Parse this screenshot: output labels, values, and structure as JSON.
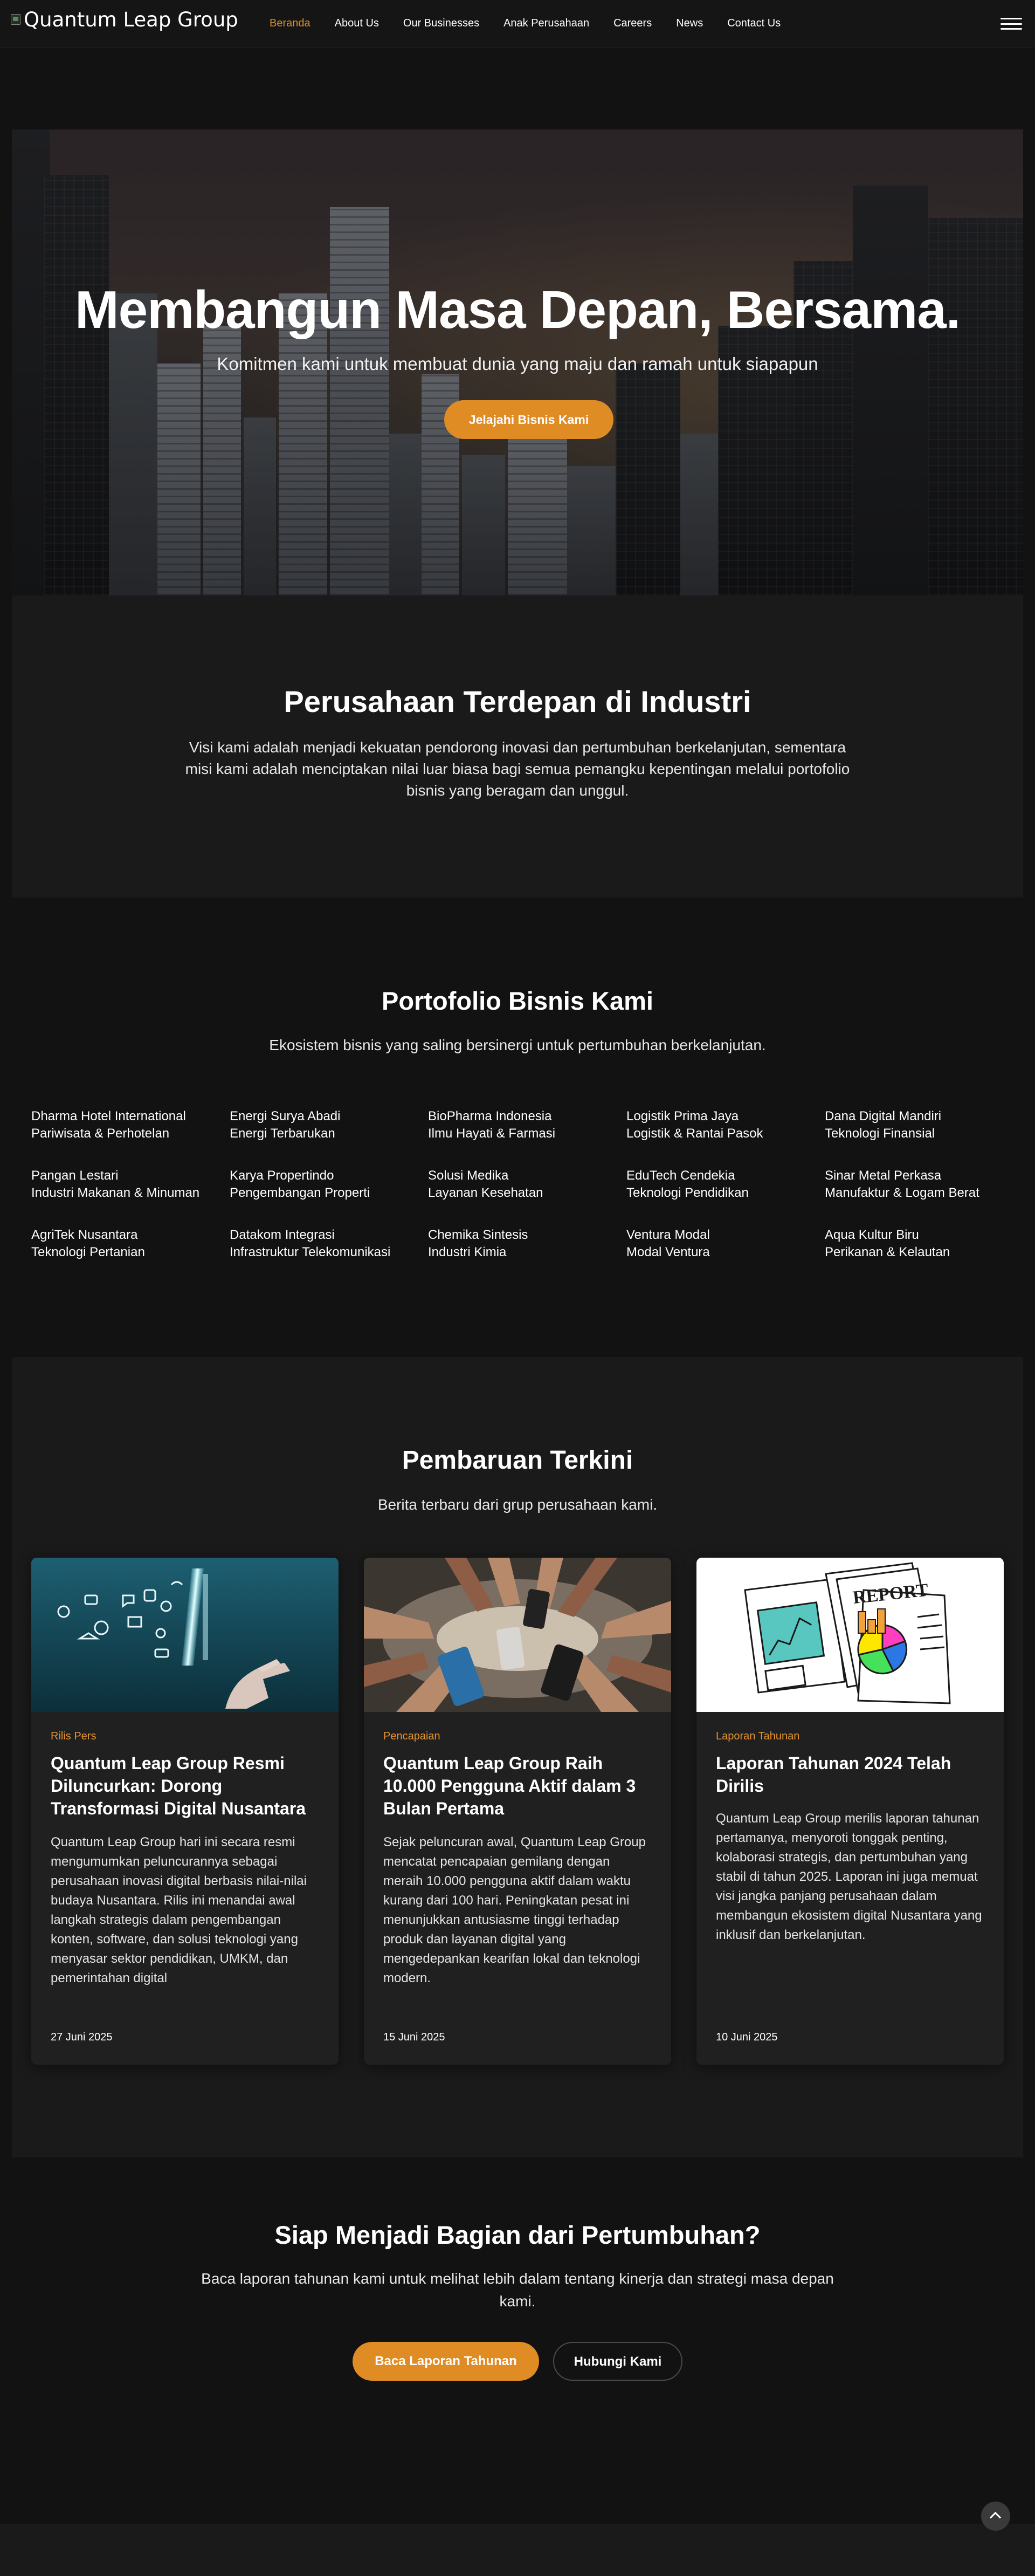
{
  "nav": {
    "logo_text": "Quantum Leap Group",
    "items": [
      {
        "label": "Beranda",
        "active": true
      },
      {
        "label": "About Us"
      },
      {
        "label": "Our Businesses"
      },
      {
        "label": "Anak Perusahaan"
      },
      {
        "label": "Careers"
      },
      {
        "label": "News"
      },
      {
        "label": "Contact Us"
      }
    ]
  },
  "hero": {
    "title": "Membangun Masa Depan, Bersama.",
    "subtitle": "Komitmen kami untuk membuat dunia yang maju dan ramah untuk siapapun",
    "button": "Jelajahi Bisnis Kami"
  },
  "about": {
    "title": "Perusahaan Terdepan di Industri",
    "text": "Visi kami adalah menjadi kekuatan pendorong inovasi dan pertumbuhan berkelanjutan, sementara misi kami adalah menciptakan nilai luar biasa bagi semua pemangku kepentingan melalui portofolio bisnis yang beragam dan unggul."
  },
  "portfolio": {
    "title": "Portofolio Bisnis Kami",
    "subtitle": "Ekosistem bisnis yang saling bersinergi untuk pertumbuhan berkelanjutan.",
    "items": [
      {
        "name": "Dharma Hotel International",
        "category": "Pariwisata & Perhotelan"
      },
      {
        "name": "Energi Surya Abadi",
        "category": "Energi Terbarukan"
      },
      {
        "name": "BioPharma Indonesia",
        "category": "Ilmu Hayati & Farmasi"
      },
      {
        "name": "Logistik Prima Jaya",
        "category": "Logistik & Rantai Pasok"
      },
      {
        "name": "Dana Digital Mandiri",
        "category": "Teknologi Finansial"
      },
      {
        "name": "Pangan Lestari",
        "category": "Industri Makanan & Minuman"
      },
      {
        "name": "Karya Propertindo",
        "category": "Pengembangan Properti"
      },
      {
        "name": "Solusi Medika",
        "category": "Layanan Kesehatan"
      },
      {
        "name": "EduTech Cendekia",
        "category": "Teknologi Pendidikan"
      },
      {
        "name": "Sinar Metal Perkasa",
        "category": "Manufaktur & Logam Berat"
      },
      {
        "name": "AgriTek Nusantara",
        "category": "Teknologi Pertanian"
      },
      {
        "name": "Datakom Integrasi",
        "category": "Infrastruktur Telekomunikasi"
      },
      {
        "name": "Chemika Sintesis",
        "category": "Industri Kimia"
      },
      {
        "name": "Ventura Modal",
        "category": "Modal Ventura"
      },
      {
        "name": "Aqua Kultur Biru",
        "category": "Perikanan & Kelautan"
      }
    ]
  },
  "news": {
    "title": "Pembaruan Terkini",
    "subtitle": "Berita terbaru dari grup perusahaan kami.",
    "cards": [
      {
        "category": "Rilis Pers",
        "title": "Quantum Leap Group Resmi Diluncurkan: Dorong Transformasi Digital Nusantara",
        "body": "Quantum Leap Group hari ini secara resmi mengumumkan peluncurannya sebagai perusahaan inovasi digital berbasis nilai-nilai budaya Nusantara. Rilis ini menandai awal langkah strategis dalam pengembangan konten, software, dan solusi teknologi yang menyasar sektor pendidikan, UMKM, dan pemerintahan digital",
        "date": "27 Juni 2025",
        "image": "digital-hand-icons"
      },
      {
        "category": "Pencapaian",
        "title": "Quantum Leap Group Raih 10.000 Pengguna Aktif dalam 3 Bulan Pertama",
        "body": "Sejak peluncuran awal, Quantum Leap Group mencatat pencapaian gemilang dengan meraih 10.000 pengguna aktif dalam waktu kurang dari 100 hari. Peningkatan pesat ini menunjukkan antusiasme tinggi terhadap produk dan layanan digital yang mengedepankan kearifan lokal dan teknologi modern.",
        "date": "15 Juni 2025",
        "image": "hands-with-phones"
      },
      {
        "category": "Laporan Tahunan",
        "title": "Laporan Tahunan 2024 Telah Dirilis",
        "body": "Quantum Leap Group merilis laporan tahunan pertamanya, menyoroti tonggak penting, kolaborasi strategis, dan pertumbuhan yang stabil di tahun 2025. Laporan ini juga memuat visi jangka panjang perusahaan dalam membangun ekosistem digital Nusantara yang inklusif dan berkelanjutan.",
        "date": "10 Juni 2025",
        "image": "report-illustration",
        "report_word": "REPORT"
      }
    ]
  },
  "cta": {
    "title": "Siap Menjadi Bagian dari Pertumbuhan?",
    "text": "Baca laporan tahunan kami untuk melihat lebih dalam tentang kinerja dan strategi masa depan kami.",
    "primary": "Baca Laporan Tahunan",
    "secondary": "Hubungi Kami"
  },
  "colors": {
    "accent": "#e08c25",
    "background": "#121212",
    "section": "#1a1a1a",
    "card": "#202020"
  }
}
